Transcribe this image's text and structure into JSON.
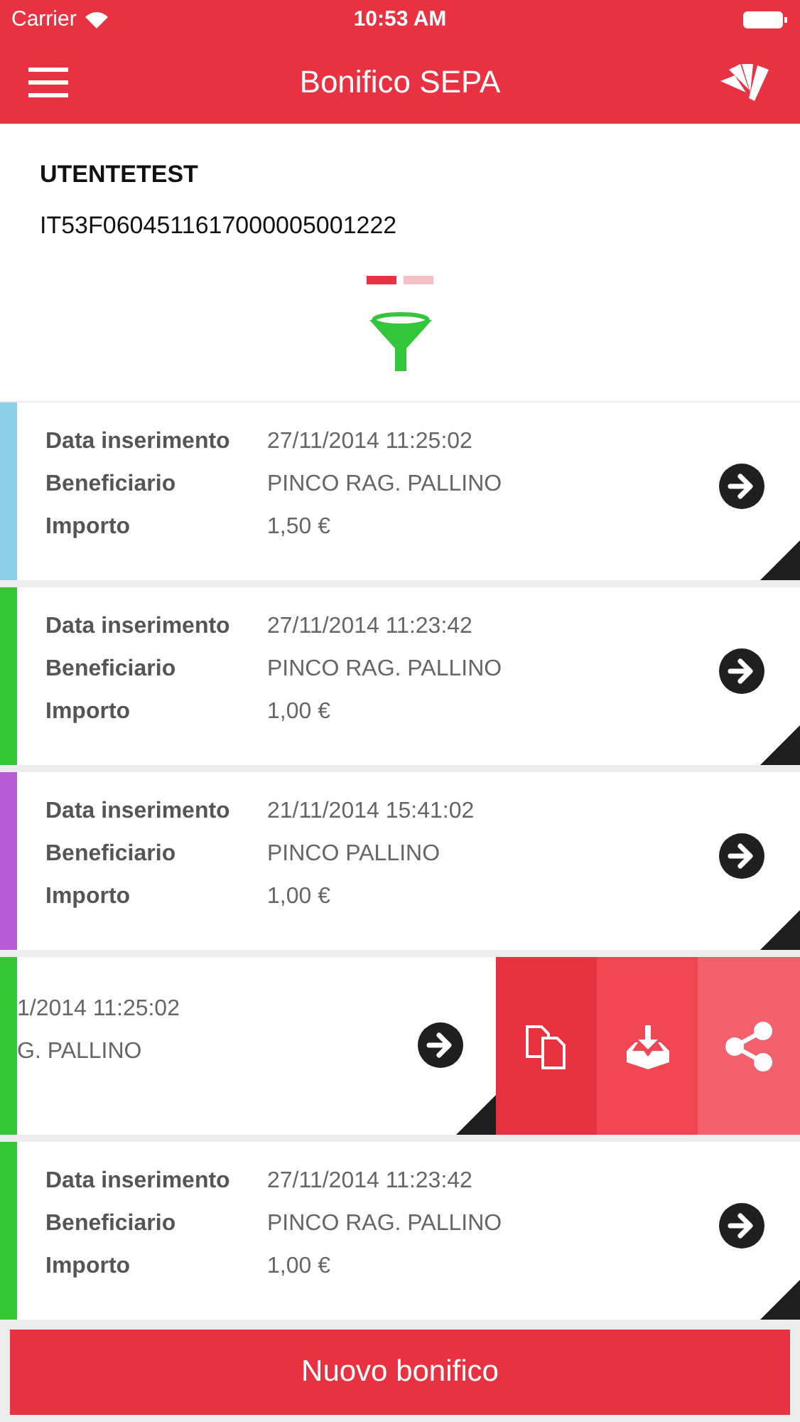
{
  "status_bar": {
    "carrier": "Carrier",
    "time": "10:53 AM"
  },
  "nav": {
    "title": "Bonifico SEPA"
  },
  "account": {
    "name": "UTENTETEST",
    "iban": "IT53F0604511617000005001222"
  },
  "pager": [
    {
      "selected": true
    },
    {
      "selected": false
    }
  ],
  "rows": [
    {
      "kind": "normal",
      "color": "#8ccfe9",
      "fields": [
        {
          "label": "Data inserimento",
          "value": "27/11/2014 11:25:02"
        },
        {
          "label": "Beneficiario",
          "value": "PINCO RAG. PALLINO"
        },
        {
          "label": "Importo",
          "value": "1,50 €"
        }
      ]
    },
    {
      "kind": "normal",
      "color": "#35c636",
      "fields": [
        {
          "label": "Data inserimento",
          "value": "27/11/2014 11:23:42"
        },
        {
          "label": "Beneficiario",
          "value": "PINCO RAG. PALLINO"
        },
        {
          "label": "Importo",
          "value": "1,00 €"
        }
      ]
    },
    {
      "kind": "normal",
      "color": "#b45ad2",
      "fields": [
        {
          "label": "Data inserimento",
          "value": "21/11/2014 15:41:02"
        },
        {
          "label": "Beneficiario",
          "value": "PINCO PALLINO"
        },
        {
          "label": "Importo",
          "value": "1,00 €"
        }
      ]
    },
    {
      "kind": "swiped",
      "color": "#35c636",
      "fields": [
        {
          "value": "1/2014 11:25:02"
        },
        {
          "value": "G. PALLINO"
        }
      ]
    },
    {
      "kind": "normal",
      "color": "#35c636",
      "fields": [
        {
          "label": "Data inserimento",
          "value": "27/11/2014 11:23:42"
        },
        {
          "label": "Beneficiario",
          "value": "PINCO RAG. PALLINO"
        },
        {
          "label": "Importo",
          "value": "1,00 €"
        }
      ]
    }
  ],
  "new_button": "Nuovo bonifico"
}
